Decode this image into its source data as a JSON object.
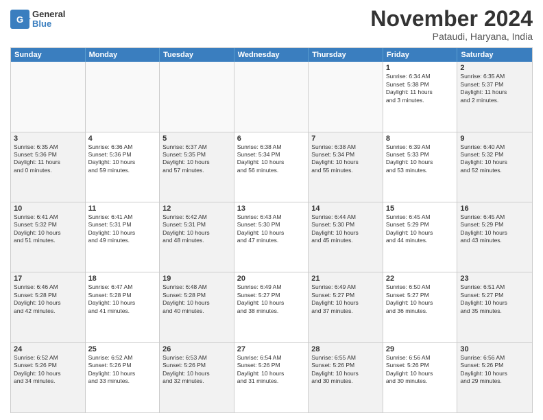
{
  "logo": {
    "general": "General",
    "blue": "Blue"
  },
  "title": "November 2024",
  "location": "Pataudi, Haryana, India",
  "weekdays": [
    "Sunday",
    "Monday",
    "Tuesday",
    "Wednesday",
    "Thursday",
    "Friday",
    "Saturday"
  ],
  "rows": [
    [
      {
        "day": "",
        "info": "",
        "empty": true
      },
      {
        "day": "",
        "info": "",
        "empty": true
      },
      {
        "day": "",
        "info": "",
        "empty": true
      },
      {
        "day": "",
        "info": "",
        "empty": true
      },
      {
        "day": "",
        "info": "",
        "empty": true
      },
      {
        "day": "1",
        "info": "Sunrise: 6:34 AM\nSunset: 5:38 PM\nDaylight: 11 hours\nand 3 minutes.",
        "empty": false
      },
      {
        "day": "2",
        "info": "Sunrise: 6:35 AM\nSunset: 5:37 PM\nDaylight: 11 hours\nand 2 minutes.",
        "empty": false
      }
    ],
    [
      {
        "day": "3",
        "info": "Sunrise: 6:35 AM\nSunset: 5:36 PM\nDaylight: 11 hours\nand 0 minutes.",
        "empty": false
      },
      {
        "day": "4",
        "info": "Sunrise: 6:36 AM\nSunset: 5:36 PM\nDaylight: 10 hours\nand 59 minutes.",
        "empty": false
      },
      {
        "day": "5",
        "info": "Sunrise: 6:37 AM\nSunset: 5:35 PM\nDaylight: 10 hours\nand 57 minutes.",
        "empty": false
      },
      {
        "day": "6",
        "info": "Sunrise: 6:38 AM\nSunset: 5:34 PM\nDaylight: 10 hours\nand 56 minutes.",
        "empty": false
      },
      {
        "day": "7",
        "info": "Sunrise: 6:38 AM\nSunset: 5:34 PM\nDaylight: 10 hours\nand 55 minutes.",
        "empty": false
      },
      {
        "day": "8",
        "info": "Sunrise: 6:39 AM\nSunset: 5:33 PM\nDaylight: 10 hours\nand 53 minutes.",
        "empty": false
      },
      {
        "day": "9",
        "info": "Sunrise: 6:40 AM\nSunset: 5:32 PM\nDaylight: 10 hours\nand 52 minutes.",
        "empty": false
      }
    ],
    [
      {
        "day": "10",
        "info": "Sunrise: 6:41 AM\nSunset: 5:32 PM\nDaylight: 10 hours\nand 51 minutes.",
        "empty": false
      },
      {
        "day": "11",
        "info": "Sunrise: 6:41 AM\nSunset: 5:31 PM\nDaylight: 10 hours\nand 49 minutes.",
        "empty": false
      },
      {
        "day": "12",
        "info": "Sunrise: 6:42 AM\nSunset: 5:31 PM\nDaylight: 10 hours\nand 48 minutes.",
        "empty": false
      },
      {
        "day": "13",
        "info": "Sunrise: 6:43 AM\nSunset: 5:30 PM\nDaylight: 10 hours\nand 47 minutes.",
        "empty": false
      },
      {
        "day": "14",
        "info": "Sunrise: 6:44 AM\nSunset: 5:30 PM\nDaylight: 10 hours\nand 45 minutes.",
        "empty": false
      },
      {
        "day": "15",
        "info": "Sunrise: 6:45 AM\nSunset: 5:29 PM\nDaylight: 10 hours\nand 44 minutes.",
        "empty": false
      },
      {
        "day": "16",
        "info": "Sunrise: 6:45 AM\nSunset: 5:29 PM\nDaylight: 10 hours\nand 43 minutes.",
        "empty": false
      }
    ],
    [
      {
        "day": "17",
        "info": "Sunrise: 6:46 AM\nSunset: 5:28 PM\nDaylight: 10 hours\nand 42 minutes.",
        "empty": false
      },
      {
        "day": "18",
        "info": "Sunrise: 6:47 AM\nSunset: 5:28 PM\nDaylight: 10 hours\nand 41 minutes.",
        "empty": false
      },
      {
        "day": "19",
        "info": "Sunrise: 6:48 AM\nSunset: 5:28 PM\nDaylight: 10 hours\nand 40 minutes.",
        "empty": false
      },
      {
        "day": "20",
        "info": "Sunrise: 6:49 AM\nSunset: 5:27 PM\nDaylight: 10 hours\nand 38 minutes.",
        "empty": false
      },
      {
        "day": "21",
        "info": "Sunrise: 6:49 AM\nSunset: 5:27 PM\nDaylight: 10 hours\nand 37 minutes.",
        "empty": false
      },
      {
        "day": "22",
        "info": "Sunrise: 6:50 AM\nSunset: 5:27 PM\nDaylight: 10 hours\nand 36 minutes.",
        "empty": false
      },
      {
        "day": "23",
        "info": "Sunrise: 6:51 AM\nSunset: 5:27 PM\nDaylight: 10 hours\nand 35 minutes.",
        "empty": false
      }
    ],
    [
      {
        "day": "24",
        "info": "Sunrise: 6:52 AM\nSunset: 5:26 PM\nDaylight: 10 hours\nand 34 minutes.",
        "empty": false
      },
      {
        "day": "25",
        "info": "Sunrise: 6:52 AM\nSunset: 5:26 PM\nDaylight: 10 hours\nand 33 minutes.",
        "empty": false
      },
      {
        "day": "26",
        "info": "Sunrise: 6:53 AM\nSunset: 5:26 PM\nDaylight: 10 hours\nand 32 minutes.",
        "empty": false
      },
      {
        "day": "27",
        "info": "Sunrise: 6:54 AM\nSunset: 5:26 PM\nDaylight: 10 hours\nand 31 minutes.",
        "empty": false
      },
      {
        "day": "28",
        "info": "Sunrise: 6:55 AM\nSunset: 5:26 PM\nDaylight: 10 hours\nand 30 minutes.",
        "empty": false
      },
      {
        "day": "29",
        "info": "Sunrise: 6:56 AM\nSunset: 5:26 PM\nDaylight: 10 hours\nand 30 minutes.",
        "empty": false
      },
      {
        "day": "30",
        "info": "Sunrise: 6:56 AM\nSunset: 5:26 PM\nDaylight: 10 hours\nand 29 minutes.",
        "empty": false
      }
    ]
  ]
}
